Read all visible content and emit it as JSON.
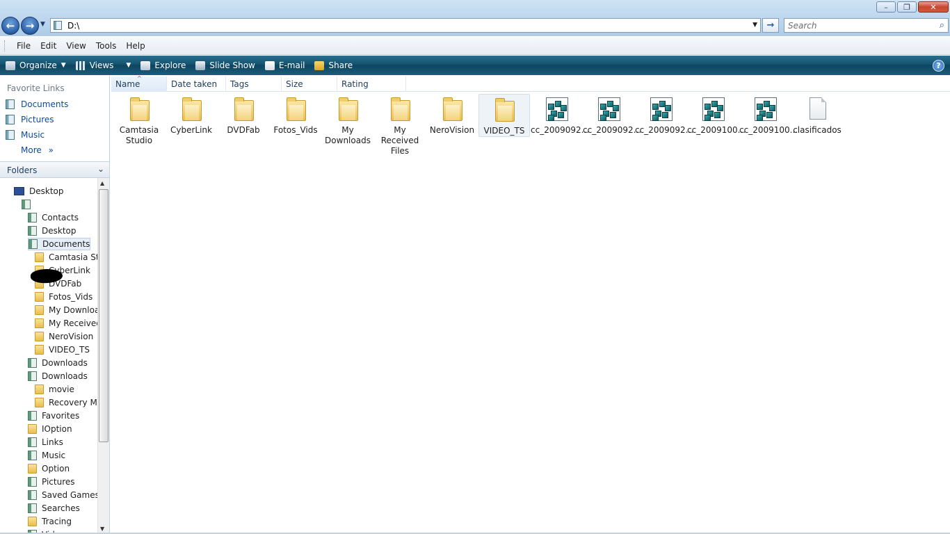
{
  "window": {
    "controls": {
      "minimize": "–",
      "maximize": "❐",
      "close": "✕"
    }
  },
  "nav": {
    "back_glyph": "←",
    "forward_glyph": "→",
    "address": "D:\\",
    "go_glyph": "→",
    "search_placeholder": "Search",
    "search_icon": "search-icon"
  },
  "menubar": {
    "items": [
      "File",
      "Edit",
      "View",
      "Tools",
      "Help"
    ]
  },
  "commandbar": {
    "items": [
      {
        "label": "Organize",
        "icon": "organize-icon",
        "has_dropdown": true
      },
      {
        "label": "Views",
        "icon": "views-icon",
        "has_dropdown": true
      },
      {
        "label": "Explore",
        "icon": "explore-icon",
        "has_dropdown": false
      },
      {
        "label": "Slide Show",
        "icon": "slideshow-icon",
        "has_dropdown": false
      },
      {
        "label": "E-mail",
        "icon": "email-icon",
        "has_dropdown": false
      },
      {
        "label": "Share",
        "icon": "share-icon",
        "has_dropdown": false
      }
    ],
    "help_glyph": "?"
  },
  "sidebar": {
    "favorites_title": "Favorite Links",
    "favorites": [
      "Documents",
      "Pictures",
      "Music"
    ],
    "more_label": "More",
    "more_glyph": "»",
    "folders_title": "Folders",
    "folders_chevron": "⌄",
    "tree": [
      {
        "label": "Desktop",
        "icon": "desktop-icon",
        "level": 0
      },
      {
        "label": "",
        "icon": "user-folder-icon",
        "level": 1
      },
      {
        "label": "Contacts",
        "icon": "library-icon",
        "level": 2
      },
      {
        "label": "Desktop",
        "icon": "library-icon",
        "level": 2
      },
      {
        "label": "Documents",
        "icon": "library-icon",
        "level": 2,
        "selected": true
      },
      {
        "label": "Camtasia Stu",
        "icon": "folder-icon",
        "level": 3
      },
      {
        "label": "CyberLink",
        "icon": "folder-icon",
        "level": 3
      },
      {
        "label": "DVDFab",
        "icon": "folder-icon",
        "level": 3
      },
      {
        "label": "Fotos_Vids",
        "icon": "folder-icon",
        "level": 3
      },
      {
        "label": "My Downloa",
        "icon": "folder-icon",
        "level": 3
      },
      {
        "label": "My Received",
        "icon": "folder-icon",
        "level": 3
      },
      {
        "label": "NeroVision",
        "icon": "folder-icon",
        "level": 3
      },
      {
        "label": "VIDEO_TS",
        "icon": "folder-icon",
        "level": 3
      },
      {
        "label": "Downloads",
        "icon": "library-icon",
        "level": 2
      },
      {
        "label": "Downloads",
        "icon": "library-icon",
        "level": 2
      },
      {
        "label": "movie",
        "icon": "folder-icon",
        "level": 3
      },
      {
        "label": "Recovery Ma",
        "icon": "folder-icon",
        "level": 3
      },
      {
        "label": "Favorites",
        "icon": "favorites-icon",
        "level": 2
      },
      {
        "label": "IOption",
        "icon": "folder-icon",
        "level": 2
      },
      {
        "label": "Links",
        "icon": "library-icon",
        "level": 2
      },
      {
        "label": "Music",
        "icon": "library-icon",
        "level": 2
      },
      {
        "label": "Option",
        "icon": "folder-icon",
        "level": 2
      },
      {
        "label": "Pictures",
        "icon": "library-icon",
        "level": 2
      },
      {
        "label": "Saved Games",
        "icon": "library-icon",
        "level": 2
      },
      {
        "label": "Searches",
        "icon": "library-icon",
        "level": 2
      },
      {
        "label": "Tracing",
        "icon": "folder-icon",
        "level": 2
      },
      {
        "label": "Videos",
        "icon": "library-icon",
        "level": 2
      }
    ],
    "scroll_up": "▲",
    "scroll_down": "▼"
  },
  "columns": [
    "Name",
    "Date taken",
    "Tags",
    "Size",
    "Rating"
  ],
  "sort_glyph": "^",
  "items": [
    {
      "label": "Camtasia Studio",
      "icon": "folder-icon"
    },
    {
      "label": "CyberLink",
      "icon": "folder-icon"
    },
    {
      "label": "DVDFab",
      "icon": "folder-icon"
    },
    {
      "label": "Fotos_Vids",
      "icon": "folder-icon"
    },
    {
      "label": "My Downloads",
      "icon": "folder-icon"
    },
    {
      "label": "My Received Files",
      "icon": "folder-icon"
    },
    {
      "label": "NeroVision",
      "icon": "folder-icon"
    },
    {
      "label": "VIDEO_TS",
      "icon": "folder-icon",
      "selected": true
    },
    {
      "label": "cc_2009092...",
      "icon": "spreadsheet-icon"
    },
    {
      "label": "cc_2009092...",
      "icon": "spreadsheet-icon"
    },
    {
      "label": "cc_2009092...",
      "icon": "spreadsheet-icon"
    },
    {
      "label": "cc_2009100...",
      "icon": "spreadsheet-icon"
    },
    {
      "label": "cc_2009100...",
      "icon": "spreadsheet-icon"
    },
    {
      "label": "clasificados",
      "icon": "document-icon"
    }
  ]
}
